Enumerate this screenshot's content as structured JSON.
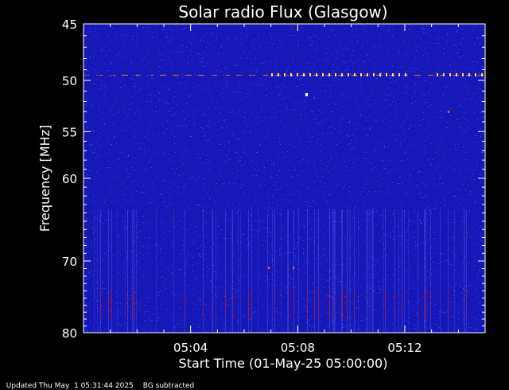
{
  "chart_data": {
    "type": "heatmap",
    "title": "Solar radio Flux (Glasgow)",
    "xlabel": "Start Time (01-May-25 05:00:00)",
    "ylabel": "Frequency [MHz]",
    "x_tick_labels": [
      "05:04",
      "05:08",
      "05:12"
    ],
    "x_tick_minutes": [
      4,
      8,
      12
    ],
    "x_range_minutes": [
      0,
      15
    ],
    "y_tick_labels": [
      "45",
      "50",
      "55",
      "60",
      "70",
      "80"
    ],
    "y_tick_values": [
      45,
      50,
      55,
      60,
      70,
      80
    ],
    "y_range": [
      45,
      80
    ],
    "y_scale": "log",
    "colormap": [
      "#1c1ca4",
      "#3434dc",
      "#d01818",
      "#ffffff"
    ],
    "features": [
      {
        "description": "persistent interference line",
        "frequency_mhz": 49.5,
        "time_minutes": [
          0,
          15
        ]
      },
      {
        "description": "lower band of vertical striations",
        "frequency_mhz": [
          74,
          78
        ],
        "time_minutes": [
          0,
          15
        ]
      }
    ]
  },
  "footer": {
    "updated": "Updated Thu May  1 05:31:44 2025",
    "status": "BG subtracted"
  },
  "colors": {
    "background": "#000000",
    "foreground": "#ffffff",
    "plot_fill": "#2020b8"
  }
}
